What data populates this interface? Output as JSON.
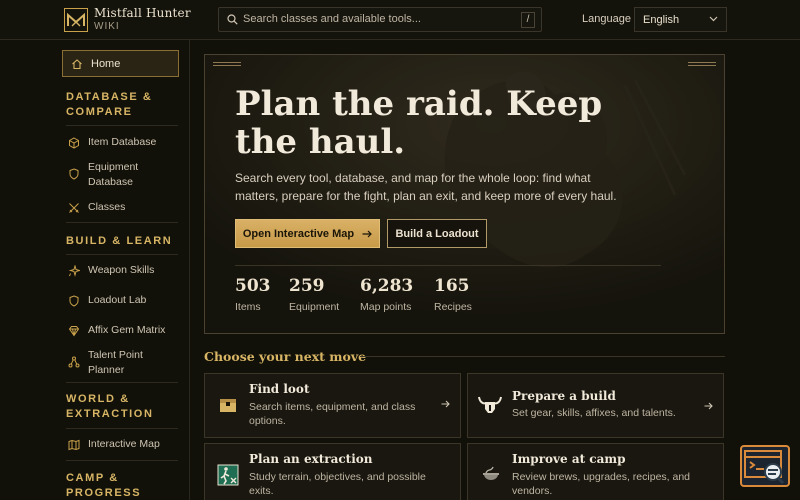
{
  "brand": {
    "name": "Mistfall Hunter",
    "subtitle": "WIKI"
  },
  "search": {
    "placeholder": "Search classes and available tools...",
    "shortcut": "/"
  },
  "language": {
    "label": "Language",
    "value": "English"
  },
  "sidebar": {
    "home": "Home",
    "sections": [
      {
        "title": "DATABASE & COMPARE",
        "items": [
          "Item Database",
          "Equipment Database",
          "Classes"
        ]
      },
      {
        "title": "BUILD & LEARN",
        "items": [
          "Weapon Skills",
          "Loadout Lab",
          "Affix Gem Matrix",
          "Talent Point Planner"
        ]
      },
      {
        "title": "WORLD & EXTRACTION",
        "items": [
          "Interactive Map"
        ]
      },
      {
        "title": "CAMP & PROGRESS",
        "items": []
      }
    ]
  },
  "hero": {
    "title": "Plan the raid. Keep the haul.",
    "description": "Search every tool, database, and map for the whole loop: find what matters, prepare for the fight, plan an exit, and keep more of every haul.",
    "primary_button": "Open Interactive Map",
    "secondary_button": "Build a Loadout",
    "stats": [
      {
        "value": "503",
        "label": "Items"
      },
      {
        "value": "259",
        "label": "Equipment"
      },
      {
        "value": "6,283",
        "label": "Map points"
      },
      {
        "value": "165",
        "label": "Recipes"
      }
    ]
  },
  "choose": {
    "title": "Choose your next move",
    "cards": [
      {
        "title": "Find loot",
        "desc": "Search items, equipment, and class options.",
        "icon": "chest-icon"
      },
      {
        "title": "Prepare a build",
        "desc": "Set gear, skills, affixes, and talents.",
        "icon": "horned-helm-icon"
      },
      {
        "title": "Plan an extraction",
        "desc": "Study terrain, objectives, and possible exits.",
        "icon": "exit-sign-icon"
      },
      {
        "title": "Improve at camp",
        "desc": "Review brews, upgrades, recipes, and vendors.",
        "icon": "cauldron-icon"
      }
    ]
  },
  "colors": {
    "accent": "#d7b565",
    "background": "#121109",
    "button": "#d4aa5e"
  }
}
